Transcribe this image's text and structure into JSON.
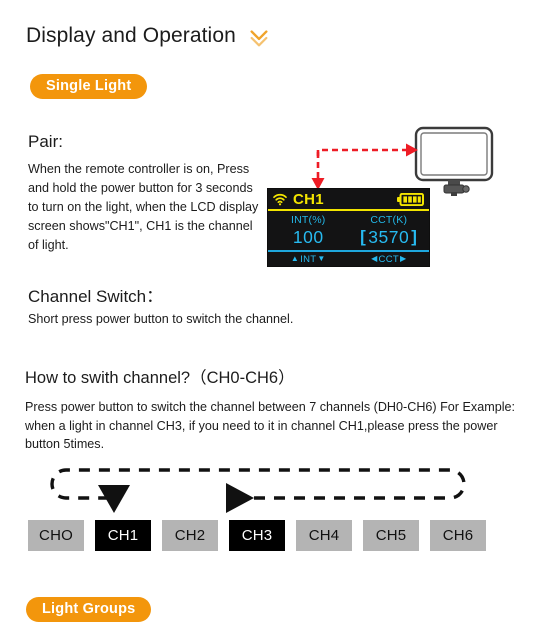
{
  "header": {
    "title": "Display and Operation",
    "chevron_icon": "chevron-double-down-icon",
    "chevron_color": "#f0a32a"
  },
  "badges": {
    "single_light": "Single Light",
    "light_groups": "Light Groups",
    "color": "#f3960c"
  },
  "sections": {
    "pair": {
      "heading": "Pair:",
      "body": "When the remote controller is on, Press and hold the power button for 3 seconds to turn on the light, when the LCD display screen shows\"CH1\", CH1 is the channel of light."
    },
    "channel_switch": {
      "heading": "Channel Switch：",
      "body": "Short press power button to switch the channel."
    },
    "how_to_switch": {
      "heading": "How to swith channel?（CH0-CH6）",
      "body": "Press power button to switch the channel between 7 channels (DH0-CH6) For Example: when a light in channel CH3,  if you need to it in channel CH1,please press the power button 5times."
    }
  },
  "lcd": {
    "wifi_icon": "wifi-signal-icon",
    "channel": "CH1",
    "battery_icon": "battery-full-icon",
    "battery_bars": 4,
    "int_label": "INT(%)",
    "cct_label": "CCT(K)",
    "int_value": "100",
    "cct_value": "3570",
    "cct_bracket_left": "[",
    "cct_bracket_right": "]",
    "footer_int": "INT",
    "footer_cct": "CCT",
    "footer_int_up_icon": "▲",
    "footer_int_down_icon": "▼",
    "footer_cct_left_icon": "◀",
    "footer_cct_right_icon": "▶",
    "accent_yellow": "#f4e500",
    "accent_cyan": "#27baf0",
    "background": "#131314"
  },
  "light_panel": {
    "icon": "led-light-panel-icon"
  },
  "pair_arrow": {
    "icon": "red-dashed-arrow-icon",
    "color": "#ee1c25"
  },
  "loop_diagram": {
    "icon": "dashed-loop-arrow-icon",
    "color": "#111111"
  },
  "channels": [
    {
      "label": "CHO",
      "active": false
    },
    {
      "label": "CH1",
      "active": true
    },
    {
      "label": "CH2",
      "active": false
    },
    {
      "label": "CH3",
      "active": true
    },
    {
      "label": "CH4",
      "active": false
    },
    {
      "label": "CH5",
      "active": false
    },
    {
      "label": "CH6",
      "active": false
    }
  ]
}
